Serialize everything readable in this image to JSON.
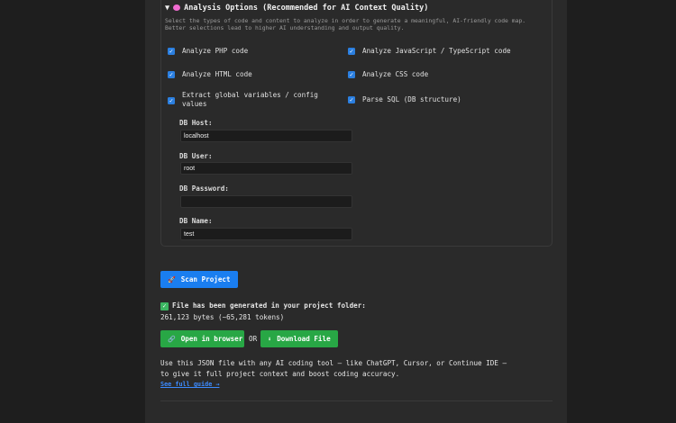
{
  "options": {
    "title": "Analysis Options (Recommended for AI Context Quality)",
    "toggle_icon": "▼",
    "description": "Select the types of code and content to analyze in order to generate a meaningful, AI-friendly code map. Better selections lead to higher AI understanding and output quality.",
    "checkboxes": [
      {
        "label": "Analyze PHP code",
        "checked": true
      },
      {
        "label": "Analyze JavaScript / TypeScript code",
        "checked": true
      },
      {
        "label": "Analyze HTML code",
        "checked": true
      },
      {
        "label": "Analyze CSS code",
        "checked": true
      },
      {
        "label": "Extract global variables / config values",
        "checked": true
      },
      {
        "label": "Parse SQL (DB structure)",
        "checked": true
      }
    ],
    "db": {
      "host_label": "DB Host:",
      "host": "localhost",
      "user_label": "DB User:",
      "user": "root",
      "password_label": "DB Password:",
      "password": "",
      "name_label": "DB Name:",
      "name": "test"
    }
  },
  "scan_button": "Scan Project",
  "result": {
    "message": "File has been generated in your project folder:",
    "size": "261,123 bytes (~65,281 tokens)",
    "open_button": "Open in browser",
    "or": "OR",
    "download_button": "Download File",
    "usage_line1": "Use this JSON file with any AI coding tool — like ChatGPT, Cursor, or Continue IDE —",
    "usage_line2": "to give it full project context and boost coding accuracy.",
    "guide_link": "See full guide →"
  },
  "colors": {
    "primary": "#1a7ef0",
    "success": "#28a745",
    "link": "#3c8bff"
  }
}
